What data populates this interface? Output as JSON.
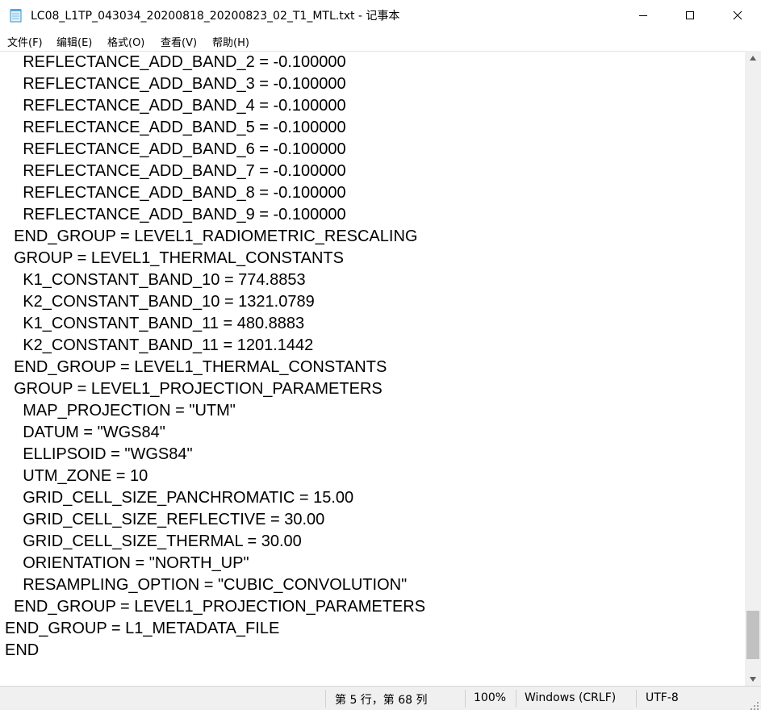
{
  "window": {
    "title": "LC08_L1TP_043034_20200818_20200823_02_T1_MTL.txt - 记事本",
    "icon": "notepad-icon"
  },
  "menu": [
    {
      "label": "文件(F)"
    },
    {
      "label": "编辑(E)"
    },
    {
      "label": "格式(O)"
    },
    {
      "label": "查看(V)"
    },
    {
      "label": "帮助(H)"
    }
  ],
  "lines": [
    "    REFLECTANCE_ADD_BAND_2 = -0.100000",
    "    REFLECTANCE_ADD_BAND_3 = -0.100000",
    "    REFLECTANCE_ADD_BAND_4 = -0.100000",
    "    REFLECTANCE_ADD_BAND_5 = -0.100000",
    "    REFLECTANCE_ADD_BAND_6 = -0.100000",
    "    REFLECTANCE_ADD_BAND_7 = -0.100000",
    "    REFLECTANCE_ADD_BAND_8 = -0.100000",
    "    REFLECTANCE_ADD_BAND_9 = -0.100000",
    "  END_GROUP = LEVEL1_RADIOMETRIC_RESCALING",
    "  GROUP = LEVEL1_THERMAL_CONSTANTS",
    "    K1_CONSTANT_BAND_10 = 774.8853",
    "    K2_CONSTANT_BAND_10 = 1321.0789",
    "    K1_CONSTANT_BAND_11 = 480.8883",
    "    K2_CONSTANT_BAND_11 = 1201.1442",
    "  END_GROUP = LEVEL1_THERMAL_CONSTANTS",
    "  GROUP = LEVEL1_PROJECTION_PARAMETERS",
    "    MAP_PROJECTION = \"UTM\"",
    "    DATUM = \"WGS84\"",
    "    ELLIPSOID = \"WGS84\"",
    "    UTM_ZONE = 10",
    "    GRID_CELL_SIZE_PANCHROMATIC = 15.00",
    "    GRID_CELL_SIZE_REFLECTIVE = 30.00",
    "    GRID_CELL_SIZE_THERMAL = 30.00",
    "    ORIENTATION = \"NORTH_UP\"",
    "    RESAMPLING_OPTION = \"CUBIC_CONVOLUTION\"",
    "  END_GROUP = LEVEL1_PROJECTION_PARAMETERS",
    "END_GROUP = L1_METADATA_FILE",
    "END"
  ],
  "status": {
    "position": "第 5 行，第 68 列",
    "zoom": "100%",
    "line_ending": "Windows (CRLF)",
    "encoding": "UTF-8"
  },
  "scroll": {
    "vertical_position_fraction": 0.95
  }
}
